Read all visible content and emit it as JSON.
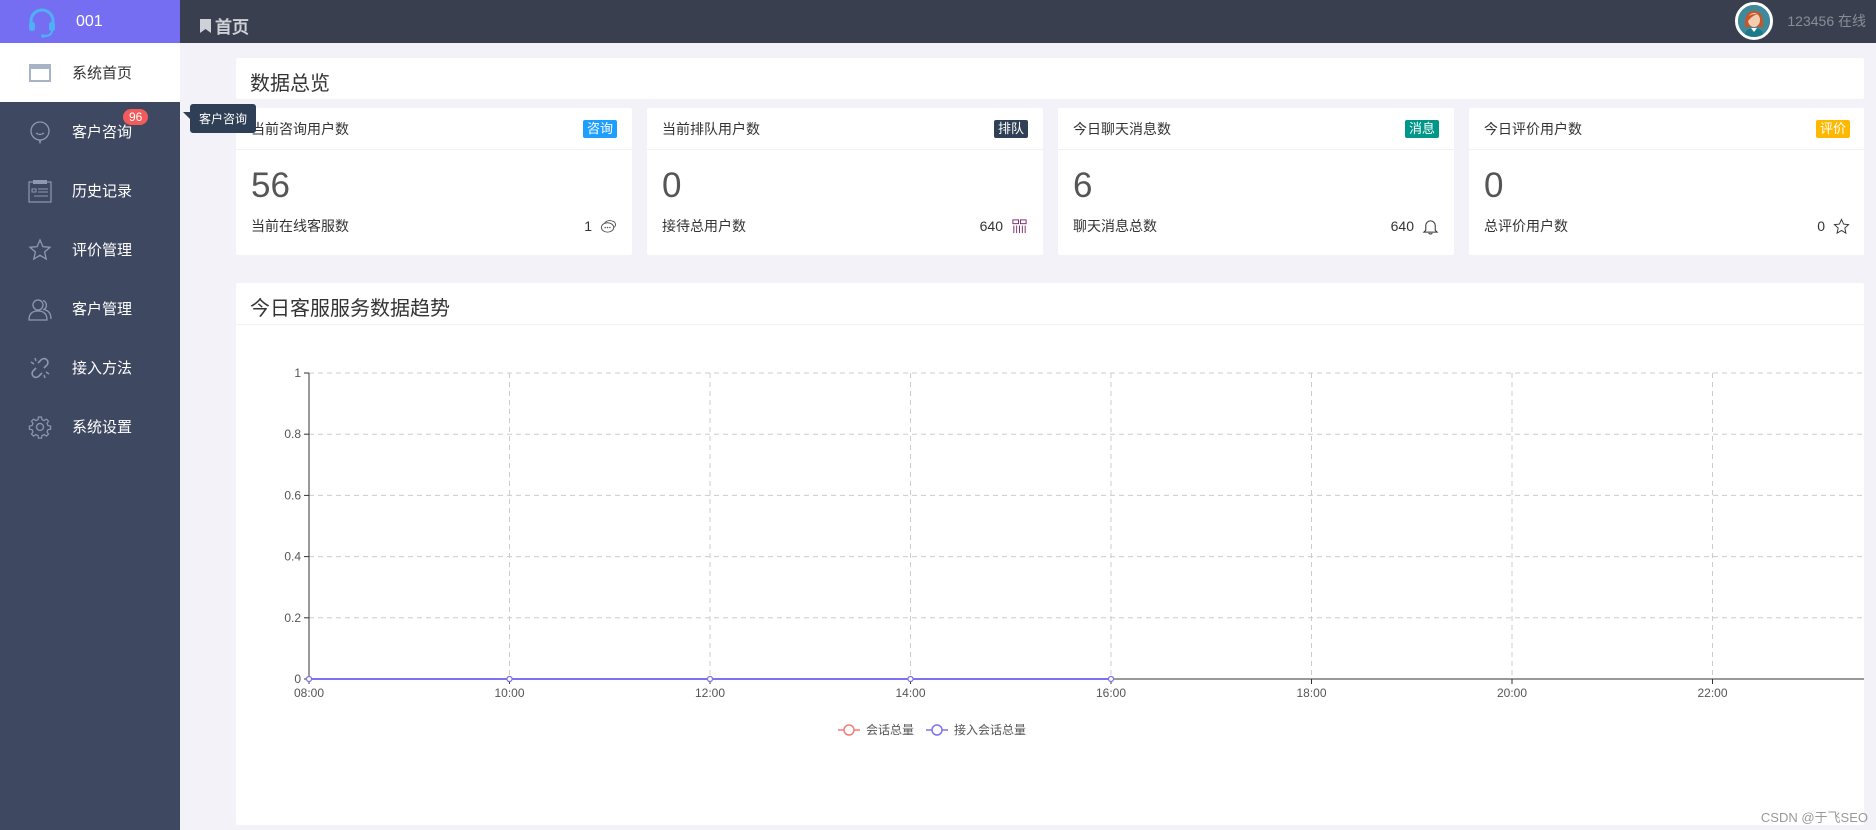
{
  "brand": {
    "label": "001",
    "icon": "headset-icon"
  },
  "sidebar": {
    "items": [
      {
        "label": "系统首页",
        "icon": "window-icon",
        "active": true
      },
      {
        "label": "客户咨询",
        "icon": "chat-bubble-icon",
        "badge": "96"
      },
      {
        "label": "历史记录",
        "icon": "calendar-list-icon"
      },
      {
        "label": "评价管理",
        "icon": "star-icon"
      },
      {
        "label": "客户管理",
        "icon": "users-icon"
      },
      {
        "label": "接入方法",
        "icon": "link-broken-icon"
      },
      {
        "label": "系统设置",
        "icon": "gear-icon"
      }
    ],
    "tooltip": "客户咨询"
  },
  "header": {
    "breadcrumb": "首页",
    "user": "123456 在线"
  },
  "overview": {
    "title": "数据总览"
  },
  "cards": [
    {
      "title": "当前咨询用户数",
      "tag": "咨询",
      "tag_color": "#1e9fff",
      "value": "56",
      "foot_label": "当前在线客服数",
      "foot_value": "1",
      "foot_icon": "chat-icon"
    },
    {
      "title": "当前排队用户数",
      "tag": "排队",
      "tag_color": "#2f4056",
      "value": "0",
      "foot_label": "接待总用户数",
      "foot_value": "640",
      "foot_icon": "queue-icon"
    },
    {
      "title": "今日聊天消息数",
      "tag": "消息",
      "tag_color": "#009688",
      "value": "6",
      "foot_label": "聊天消息总数",
      "foot_value": "640",
      "foot_icon": "bell-icon"
    },
    {
      "title": "今日评价用户数",
      "tag": "评价",
      "tag_color": "#ffb800",
      "value": "0",
      "foot_label": "总评价用户数",
      "foot_value": "0",
      "foot_icon": "star-icon"
    }
  ],
  "chart_panel": {
    "title": "今日客服服务数据趋势"
  },
  "chart_data": {
    "type": "line",
    "title": "今日客服服务数据趋势",
    "xlabel": "",
    "ylabel": "",
    "x": [
      "08:00",
      "10:00",
      "12:00",
      "14:00",
      "16:00"
    ],
    "x_ticks": [
      "08:00",
      "10:00",
      "12:00",
      "14:00",
      "16:00",
      "18:00",
      "20:00",
      "22:00"
    ],
    "x_range_hours": [
      8,
      23.5
    ],
    "y_ticks": [
      "0",
      "0.2",
      "0.4",
      "0.6",
      "0.8",
      "1"
    ],
    "ylim": [
      0,
      1
    ],
    "grid": true,
    "legend_position": "bottom-center",
    "series": [
      {
        "name": "会话总量",
        "color": "#f47b7b",
        "values": [
          0,
          0,
          0,
          0,
          0
        ]
      },
      {
        "name": "接入会话总量",
        "color": "#7b74f0",
        "values": [
          0,
          0,
          0,
          0,
          0
        ]
      }
    ]
  },
  "watermark": "CSDN @于飞SEO"
}
